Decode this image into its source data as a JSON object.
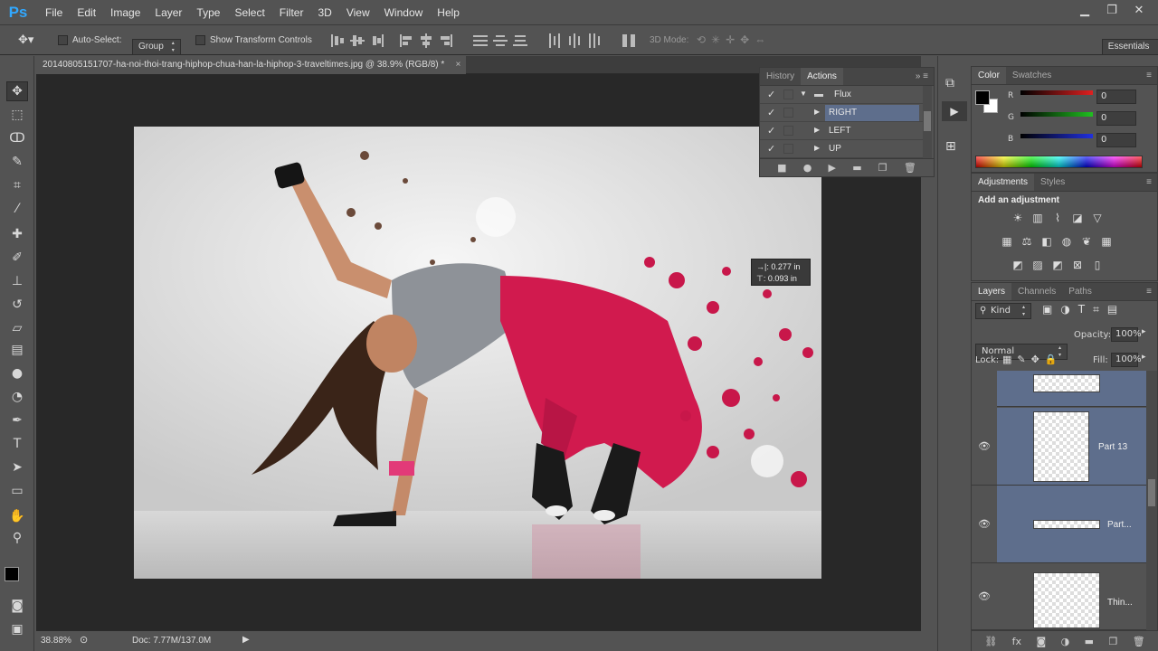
{
  "app": {
    "logo": "Ps"
  },
  "menubar": {
    "items": [
      "File",
      "Edit",
      "Image",
      "Layer",
      "Type",
      "Select",
      "Filter",
      "3D",
      "View",
      "Window",
      "Help"
    ]
  },
  "window_controls": {
    "minimize": "▁",
    "restore": "❐",
    "close": "✕"
  },
  "options": {
    "auto_select_label": "Auto-Select:",
    "auto_select_value": "Group",
    "show_transform_label": "Show Transform Controls",
    "mode_3d_label": "3D Mode:",
    "workspace": "Essentials"
  },
  "document": {
    "tab_title": "20140805151707-ha-noi-thoi-trang-hiphop-chua-han-la-hiphop-3-traveltimes.jpg @ 38.9% (RGB/8) *",
    "close": "×",
    "measure_x": "0.277 in",
    "measure_y": "0.093 in",
    "measure_x_prefix": "→|:",
    "measure_y_prefix": "⊤:"
  },
  "status": {
    "zoom": "38.88%",
    "doc_info": "Doc: 7.77M/137.0M"
  },
  "history_actions": {
    "tabs": [
      "History",
      "Actions"
    ],
    "active_tab": "Actions",
    "rows": [
      {
        "label": "Flux",
        "type": "folder"
      },
      {
        "label": "RIGHT",
        "type": "action",
        "selected": true
      },
      {
        "label": "LEFT",
        "type": "action"
      },
      {
        "label": "UP",
        "type": "action"
      }
    ]
  },
  "color_panel": {
    "tabs": [
      "Color",
      "Swatches"
    ],
    "active_tab": "Color",
    "channels": [
      {
        "label": "R",
        "value": "0"
      },
      {
        "label": "G",
        "value": "0"
      },
      {
        "label": "B",
        "value": "0"
      }
    ],
    "colors": {
      "r": "#e02020",
      "g": "#20c020",
      "b": "#2030e0"
    }
  },
  "adjustments_panel": {
    "tabs": [
      "Adjustments",
      "Styles"
    ],
    "active_tab": "Adjustments",
    "heading": "Add an adjustment"
  },
  "layers_panel": {
    "tabs": [
      "Layers",
      "Channels",
      "Paths"
    ],
    "active_tab": "Layers",
    "filter_kind": "Kind",
    "blend_mode": "Normal",
    "opacity_label": "Opacity:",
    "opacity_value": "100%",
    "lock_label": "Lock:",
    "fill_label": "Fill:",
    "fill_value": "100%",
    "layers": [
      {
        "name": "Part 13"
      },
      {
        "name": "Part..."
      },
      {
        "name": "Thin..."
      }
    ]
  },
  "accent": "#31a8ff",
  "selection_color": "#5e6e8c"
}
